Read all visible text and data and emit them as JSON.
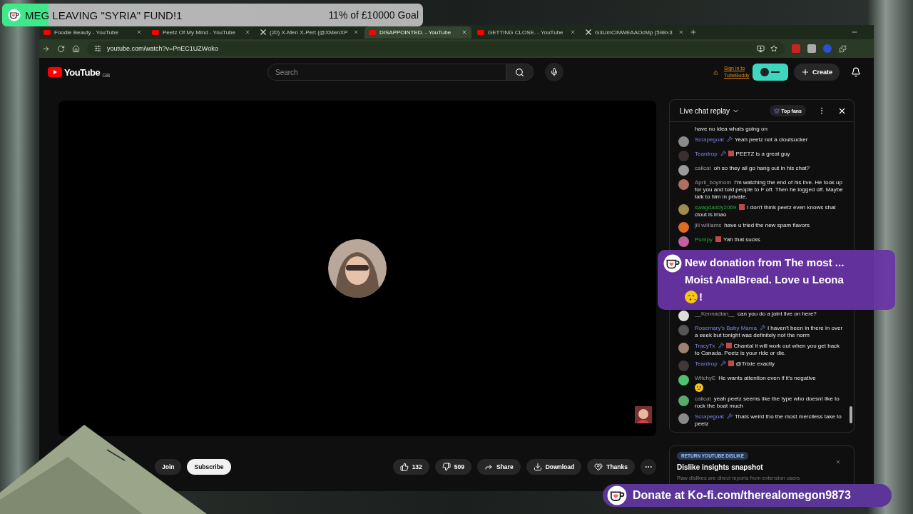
{
  "goal_overlay": {
    "title": "MEG LEAVING \"SYRIA\" FUND!1",
    "progress": "11% of £10000 Goal",
    "level": 0.11
  },
  "browser": {
    "tabs": [
      {
        "title": "Foodie Beauty - YouTube",
        "kind": "youtube",
        "selected": false
      },
      {
        "title": "Peetz Of My Mind - YouTube",
        "kind": "youtube",
        "selected": false
      },
      {
        "title": "(20) X-Men X-Pert (@XMenXP",
        "kind": "x",
        "selected": false
      },
      {
        "title": "DISAPPOINTED. - YouTube",
        "kind": "youtube",
        "selected": true
      },
      {
        "title": "GETTING CLOSE. - YouTube",
        "kind": "youtube",
        "selected": false
      },
      {
        "title": "G3UmCiNWEAAOcMp (598×3",
        "kind": "x",
        "selected": false
      }
    ],
    "url": "youtube.com/watch?v=PnEC1UZWoko"
  },
  "header": {
    "logo": "YouTube",
    "region": "GB",
    "search_placeholder": "Search",
    "tubebuddy_link": "Sign in to TubeBuddy",
    "create": "Create"
  },
  "chat": {
    "title": "Live chat replay",
    "filter": "Top fans",
    "messages": [
      {
        "kind": "continuation",
        "text": "have no idea whats going on"
      },
      {
        "kind": "message",
        "author": "Scrapegoat",
        "moderator": true,
        "member": false,
        "text": "Yeah peetz not a cloutsucker"
      },
      {
        "kind": "message",
        "author": "Teardrop",
        "moderator": true,
        "member": true,
        "text": "PEETZ is a great guy"
      },
      {
        "kind": "message",
        "author": "calicat",
        "moderator": false,
        "member": false,
        "text": "oh so they all go hang out in his chat?"
      },
      {
        "kind": "message",
        "author": "April_boymom",
        "moderator": false,
        "member": false,
        "text": "I'm watching the end of his live. He took up for you and told people to F off. Then he logged off. Maybe talk to him in private."
      },
      {
        "kind": "message",
        "author": "swagdaddy2069",
        "moderator": false,
        "member": true,
        "text": "I don't think peetz even knows shat clout is lmao"
      },
      {
        "kind": "message",
        "author": "jill williams",
        "moderator": false,
        "member": false,
        "text": "have u tried the new spam flavors"
      },
      {
        "kind": "message",
        "author": "Pumpy",
        "moderator": false,
        "member": true,
        "text": "Yah that sucks"
      },
      {
        "kind": "hidden"
      },
      {
        "kind": "message",
        "author": "__Kennadian__",
        "moderator": false,
        "member": false,
        "text": "can you do a joint live on here?"
      },
      {
        "kind": "message",
        "author": "Rosemary's Baby Mama",
        "moderator": true,
        "member": false,
        "text": "I haven't been in there in over a eeek but tonight was definitely not the norm"
      },
      {
        "kind": "message",
        "author": "TracyTx",
        "moderator": true,
        "member": true,
        "text": "Chantal it will work out when you get back to Canada. Peetz is your ride or die."
      },
      {
        "kind": "message",
        "author": "Teardrop",
        "moderator": true,
        "member": true,
        "text": "@Trixie exactly"
      },
      {
        "kind": "message",
        "author": "WitchyE",
        "moderator": false,
        "member": false,
        "emoji": true,
        "text": "He wants attention even if it's negative"
      },
      {
        "kind": "message",
        "author": "calicat",
        "moderator": false,
        "member": false,
        "text": "yeah peetz seems like the type who doesnt like to rock the boat much"
      },
      {
        "kind": "message",
        "author": "Scrapegoat",
        "moderator": true,
        "member": false,
        "text": "Thats weird tho the most merciless take to peetz"
      }
    ]
  },
  "actions": {
    "join": "Join",
    "subscribe": "Subscribe",
    "likes": "132",
    "dislikes": "509",
    "share": "Share",
    "download": "Download",
    "thanks": "Thanks"
  },
  "dislike_card": {
    "badge": "RETURN YOUTUBE DISLIKE",
    "title": "Dislike insights snapshot",
    "text": "Raw dislikes are direct reports from extension users"
  },
  "donation_alert": {
    "line1": "New donation from The most ...",
    "line2": "Moist AnalBread. Love u Leona",
    "end": "!"
  },
  "donate_banner": "Donate at Ko-fi.com/therealomegon9873"
}
